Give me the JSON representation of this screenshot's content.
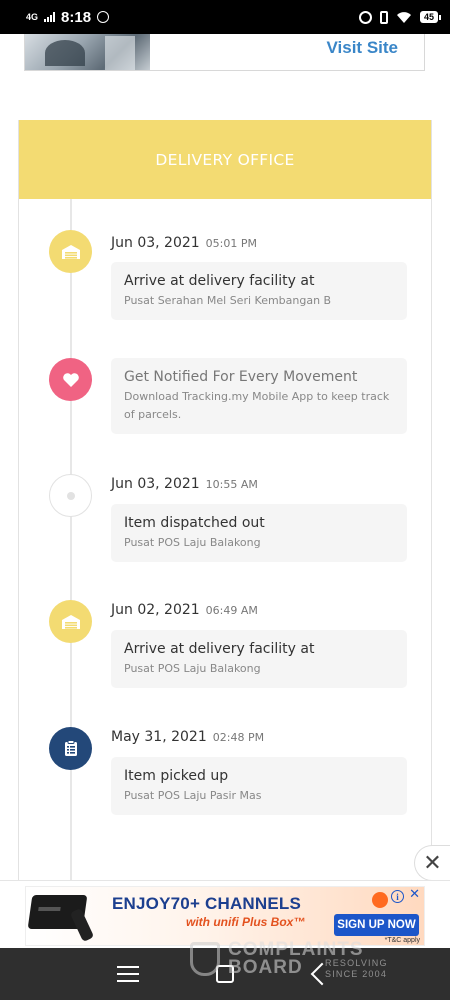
{
  "status_bar": {
    "network": "4G",
    "time": "8:18",
    "battery": "45"
  },
  "visit_card": {
    "link_label": "Visit Site"
  },
  "panel": {
    "header": "DELIVERY OFFICE"
  },
  "timeline": [
    {
      "date": "Jun 03, 2021",
      "time": "05:01 PM",
      "title": "Arrive at delivery facility at",
      "location": "Pusat Serahan Mel Seri Kembangan B",
      "icon": "warehouse-icon"
    },
    {
      "title": "Get Notified For Every Movement",
      "description": "Download Tracking.my Mobile App to keep track of parcels.",
      "icon": "heart-icon"
    },
    {
      "date": "Jun 03, 2021",
      "time": "10:55 AM",
      "title": "Item dispatched out",
      "location": "Pusat POS Laju Balakong",
      "icon": "dot-icon"
    },
    {
      "date": "Jun 02, 2021",
      "time": "06:49 AM",
      "title": "Arrive at delivery facility at",
      "location": "Pusat POS Laju Balakong",
      "icon": "warehouse-icon"
    },
    {
      "date": "May 31, 2021",
      "time": "02:48 PM",
      "title": "Item picked up",
      "location": "Pusat POS Laju Pasir Mas",
      "icon": "clipboard-icon"
    }
  ],
  "ad": {
    "headline": "ENJOY70+ CHANNELS",
    "subline": "with unifi Plus Box™",
    "cta": "SIGN UP NOW",
    "fine_print": "*T&C apply",
    "close_symbol": "✕"
  },
  "watermark": {
    "line1": "COMPLAINTS",
    "line2": "BOARD",
    "tagline": "RESOLVING SINCE 2004"
  },
  "colors": {
    "header_yellow": "#f3db72",
    "promo_pink": "#f06383",
    "pickup_blue": "#234879",
    "link_blue": "#3a86c8"
  }
}
